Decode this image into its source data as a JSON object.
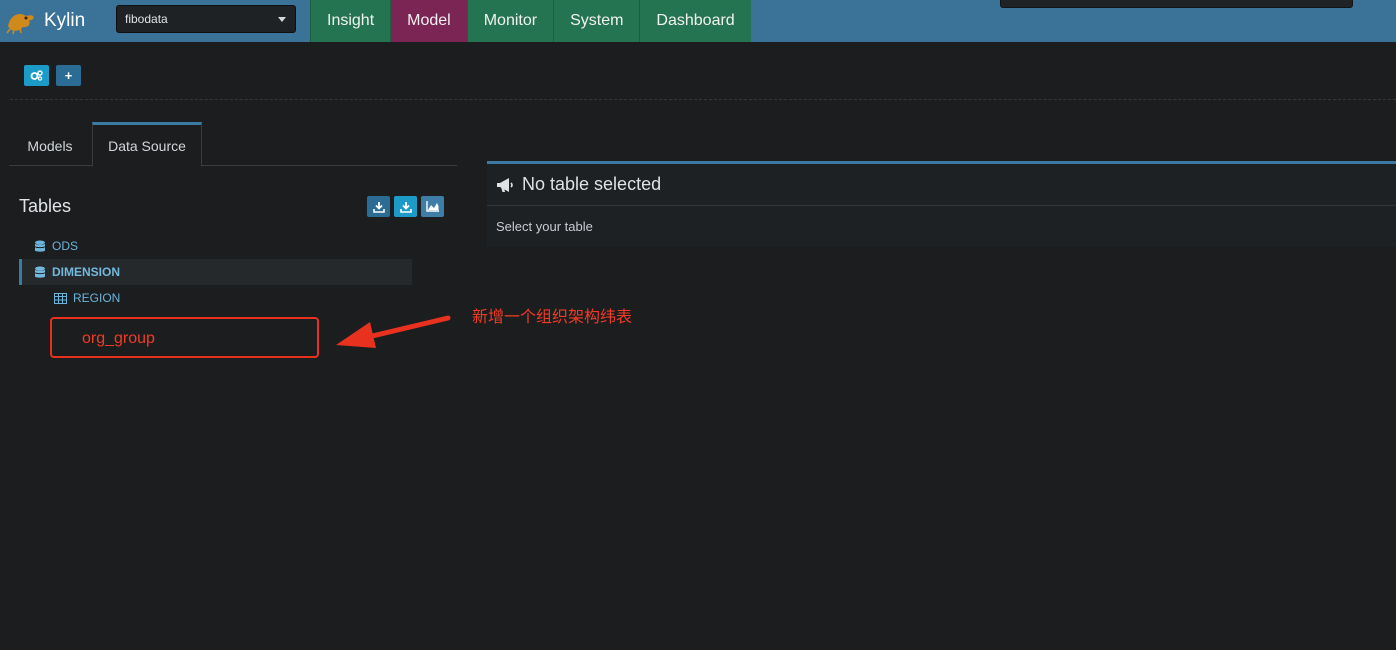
{
  "navbar": {
    "brand": "Kylin",
    "project": "fibodata",
    "tabs": [
      {
        "label": "Insight",
        "active": false
      },
      {
        "label": "Model",
        "active": true
      },
      {
        "label": "Monitor",
        "active": false
      },
      {
        "label": "System",
        "active": false
      },
      {
        "label": "Dashboard",
        "active": false
      }
    ]
  },
  "toolbar": {
    "settings_icon": "cogs-icon",
    "add_icon": "plus-icon",
    "add_label": "+"
  },
  "tabs": {
    "models": "Models",
    "data_source": "Data Source"
  },
  "tables": {
    "title": "Tables",
    "buttons": [
      "download-icon",
      "download-icon",
      "area-chart-icon"
    ],
    "tree": {
      "databases": [
        {
          "name": "ODS",
          "expanded": false
        },
        {
          "name": "DIMENSION",
          "expanded": true,
          "tables": [
            "REGION"
          ]
        }
      ]
    }
  },
  "annotation": {
    "highlighted_text": "org_group",
    "note": "新增一个组织架构纬表"
  },
  "detail": {
    "title": "No table selected",
    "body": "Select your table"
  },
  "colors": {
    "navbar": "#3a7298",
    "nav_tab": "#247451",
    "nav_tab_active": "#7b2554",
    "accent": "#3a7aa3",
    "annotation_red": "#e8311f"
  }
}
